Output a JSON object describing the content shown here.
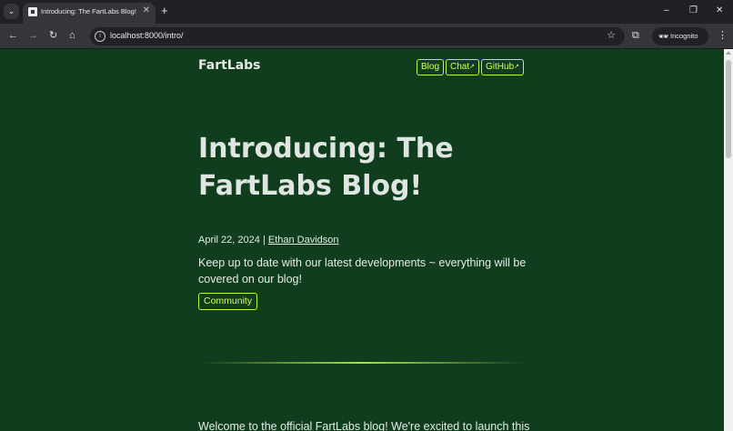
{
  "browser": {
    "tab": {
      "title": "Introducing: The FartLabs Blog!",
      "close": "✕"
    },
    "new_tab": "+",
    "window_controls": {
      "minimize": "–",
      "restore": "❐",
      "close": "✕"
    },
    "toolbar": {
      "back": "←",
      "forward": "→",
      "reload": "↻",
      "home": "⌂"
    },
    "address_bar": {
      "url": "localhost:8000/intro/"
    },
    "profile": {
      "label": "Incognito"
    },
    "icons": [
      "tab-search-icon",
      "favicon-icon",
      "back-icon",
      "forward-icon",
      "reload-icon",
      "home-icon",
      "site-info-icon",
      "bookmark-star-icon",
      "extensions-icon",
      "incognito-icon",
      "menu-icon"
    ]
  },
  "site": {
    "logo": "FartLabs",
    "nav": [
      {
        "label": "Blog",
        "external": ""
      },
      {
        "label": "Chat",
        "external": "↗"
      },
      {
        "label": "GitHub",
        "external": "↗"
      }
    ]
  },
  "post": {
    "title": "Introducing: The FartLabs Blog!",
    "date": "April 22, 2024",
    "separator": "|",
    "author": "Ethan Davidson",
    "summary": "Keep up to date with our latest developments ~ everything will be covered on our blog!",
    "tag": "Community",
    "body_start": "Welcome to the official FartLabs blog! We're excited to launch this"
  },
  "colors": {
    "page_bg": "#0f3d1e",
    "accent": "#c3f23c",
    "text": "#e6ece7",
    "chrome_dark": "#202124",
    "chrome_mid": "#35363a"
  }
}
